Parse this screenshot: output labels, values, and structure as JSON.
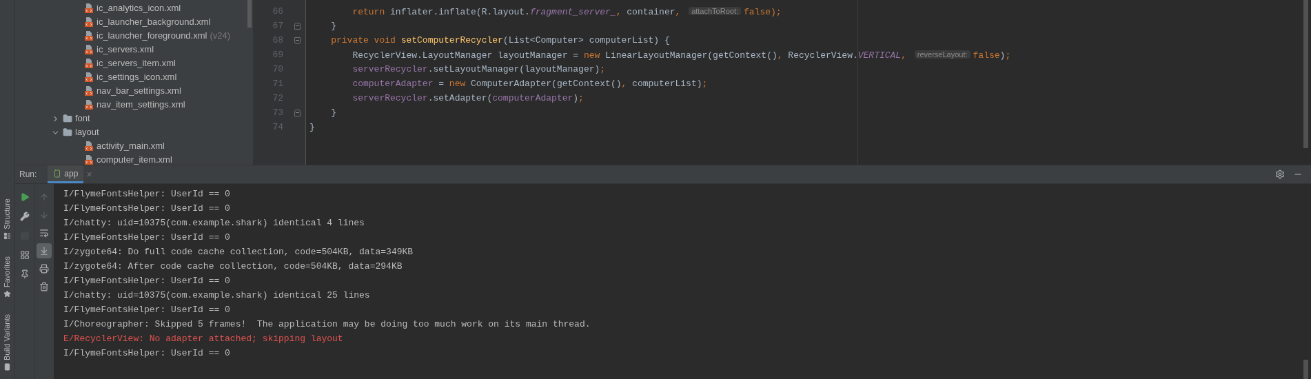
{
  "side_tools": [
    {
      "label": "Structure"
    },
    {
      "label": "Favorites"
    },
    {
      "label": "Build Variants"
    }
  ],
  "tree": [
    {
      "kind": "group",
      "children": [
        {
          "kind": "file",
          "label": "ic_analytics_icon.xml"
        },
        {
          "kind": "file",
          "label": "ic_launcher_background.xml"
        },
        {
          "kind": "file",
          "label": "ic_launcher_foreground.xml",
          "qualifier": "(v24)"
        },
        {
          "kind": "file",
          "label": "ic_servers.xml"
        },
        {
          "kind": "file",
          "label": "ic_servers_item.xml"
        },
        {
          "kind": "file",
          "label": "ic_settings_icon.xml"
        },
        {
          "kind": "file",
          "label": "nav_bar_settings.xml"
        },
        {
          "kind": "file",
          "label": "nav_item_settings.xml"
        }
      ]
    },
    {
      "kind": "folder",
      "label": "font",
      "expanded": false
    },
    {
      "kind": "folder",
      "label": "layout",
      "expanded": true,
      "children": [
        {
          "kind": "file",
          "label": "activity_main.xml"
        },
        {
          "kind": "file",
          "label": "computer_item.xml"
        }
      ]
    }
  ],
  "code": [
    {
      "number": "66",
      "kind": "plain",
      "tokens": [
        {
          "kind": "kw",
          "s": "        return "
        },
        {
          "kind": "plain",
          "s": "inflater.inflate(R.layout."
        },
        {
          "kind": "static",
          "s": "fragment_server_"
        },
        {
          "kind": "kw",
          "s": ", "
        },
        {
          "kind": "plain",
          "s": "container"
        },
        {
          "kind": "kw",
          "s": ", "
        },
        {
          "kind": "hint",
          "s": "attachToRoot:"
        },
        {
          "kind": "kw",
          "s": "false);"
        }
      ]
    },
    {
      "number": "67",
      "kind": "fold_end",
      "tokens": [
        {
          "kind": "plain",
          "s": "    }"
        }
      ]
    },
    {
      "number": "68",
      "kind": "fold_start",
      "tokens": [
        {
          "kind": "kw",
          "s": "    private void "
        },
        {
          "kind": "method",
          "s": "setComputerRecycler"
        },
        {
          "kind": "plain",
          "s": "(List<Computer> computerList) {"
        }
      ]
    },
    {
      "number": "69",
      "kind": "plain",
      "tokens": [
        {
          "kind": "plain",
          "s": "        RecyclerView.LayoutManager layoutManager = "
        },
        {
          "kind": "kw",
          "s": "new "
        },
        {
          "kind": "plain",
          "s": "LinearLayoutManager(getContext()"
        },
        {
          "kind": "kw",
          "s": ", "
        },
        {
          "kind": "plain",
          "s": "RecyclerView."
        },
        {
          "kind": "static",
          "s": "VERTICAL"
        },
        {
          "kind": "kw",
          "s": ", "
        },
        {
          "kind": "hint",
          "s": "reverseLayout:"
        },
        {
          "kind": "kw",
          "s": "false"
        },
        {
          "kind": "plain",
          "s": ")"
        },
        {
          "kind": "kw",
          "s": ";"
        }
      ]
    },
    {
      "number": "70",
      "kind": "plain",
      "tokens": [
        {
          "kind": "field",
          "s": "        serverRecycler"
        },
        {
          "kind": "plain",
          "s": ".setLayoutManager(layoutManager)"
        },
        {
          "kind": "kw",
          "s": ";"
        }
      ]
    },
    {
      "number": "71",
      "kind": "plain",
      "tokens": [
        {
          "kind": "field",
          "s": "        computerAdapter"
        },
        {
          "kind": "plain",
          "s": " = "
        },
        {
          "kind": "kw",
          "s": "new "
        },
        {
          "kind": "plain",
          "s": "ComputerAdapter(getContext()"
        },
        {
          "kind": "kw",
          "s": ", "
        },
        {
          "kind": "plain",
          "s": "computerList)"
        },
        {
          "kind": "kw",
          "s": ";"
        }
      ]
    },
    {
      "number": "72",
      "kind": "plain",
      "tokens": [
        {
          "kind": "field",
          "s": "        serverRecycler"
        },
        {
          "kind": "plain",
          "s": ".setAdapter("
        },
        {
          "kind": "field",
          "s": "computerAdapter"
        },
        {
          "kind": "plain",
          "s": ")"
        },
        {
          "kind": "kw",
          "s": ";"
        }
      ]
    },
    {
      "number": "73",
      "kind": "fold_end",
      "tokens": [
        {
          "kind": "plain",
          "s": "    }"
        }
      ]
    },
    {
      "number": "74",
      "kind": "plain",
      "tokens": [
        {
          "kind": "plain",
          "s": "}"
        }
      ]
    }
  ],
  "run": {
    "label": "Run:",
    "tab": {
      "label": "app",
      "selected": true,
      "close": "×"
    },
    "toolbar_left": [
      {
        "kind": "run",
        "disabled": false
      },
      {
        "kind": "build",
        "disabled": false
      },
      {
        "kind": "stop",
        "disabled": true
      },
      {
        "kind": "layout",
        "disabled": false
      },
      {
        "kind": "pin",
        "disabled": false
      }
    ],
    "toolbar_right": [
      {
        "kind": "up",
        "disabled": true,
        "on": false
      },
      {
        "kind": "down",
        "disabled": true,
        "on": false
      },
      {
        "kind": "wrap",
        "disabled": false,
        "on": false
      },
      {
        "kind": "scroll_end",
        "disabled": false,
        "on": true
      },
      {
        "kind": "print",
        "disabled": false,
        "on": false
      },
      {
        "kind": "delete",
        "disabled": false,
        "on": false
      }
    ],
    "log": [
      {
        "kind": "info",
        "text": "I/FlymeFontsHelper: UserId == 0"
      },
      {
        "kind": "info",
        "text": "I/FlymeFontsHelper: UserId == 0"
      },
      {
        "kind": "info",
        "text": "I/chatty: uid=10375(com.example.shark) identical 4 lines"
      },
      {
        "kind": "info",
        "text": "I/FlymeFontsHelper: UserId == 0"
      },
      {
        "kind": "info",
        "text": "I/zygote64: Do full code cache collection, code=504KB, data=349KB"
      },
      {
        "kind": "info",
        "text": "I/zygote64: After code cache collection, code=504KB, data=294KB"
      },
      {
        "kind": "info",
        "text": "I/FlymeFontsHelper: UserId == 0"
      },
      {
        "kind": "info",
        "text": "I/chatty: uid=10375(com.example.shark) identical 25 lines"
      },
      {
        "kind": "info",
        "text": "I/FlymeFontsHelper: UserId == 0"
      },
      {
        "kind": "info",
        "text": "I/Choreographer: Skipped 5 frames!  The application may be doing too much work on its main thread."
      },
      {
        "kind": "error",
        "text": "E/RecyclerView: No adapter attached; skipping layout"
      },
      {
        "kind": "info",
        "text": "I/FlymeFontsHelper: UserId == 0"
      }
    ]
  }
}
